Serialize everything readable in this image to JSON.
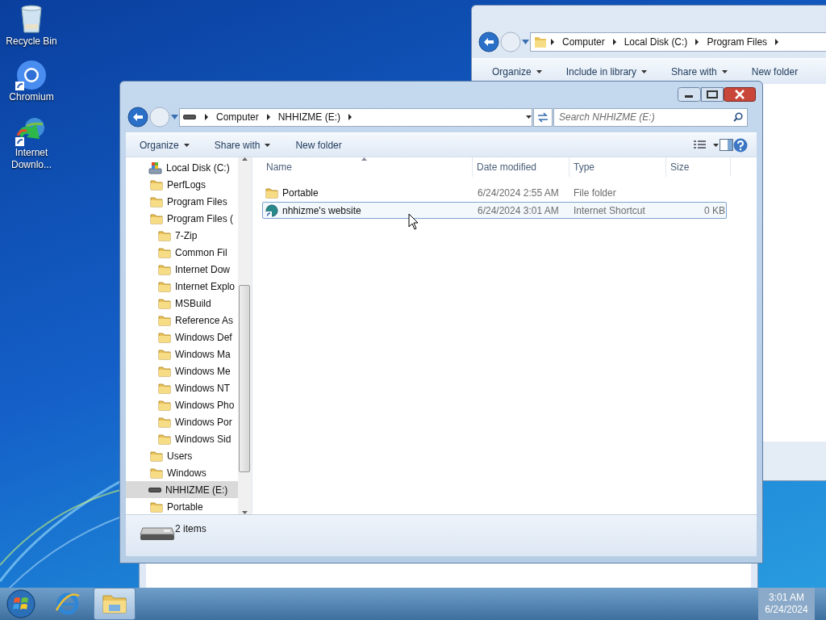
{
  "desktop_icons": [
    {
      "label": "Recycle Bin",
      "kind": "recycle"
    },
    {
      "label": "Chromium",
      "kind": "chromium"
    },
    {
      "label": "Internet Downlo...",
      "kind": "downloader"
    }
  ],
  "back_window": {
    "breadcrumb": [
      "Computer",
      "Local Disk (C:)",
      "Program Files"
    ],
    "toolbar": [
      {
        "label": "Organize",
        "dropdown": true
      },
      {
        "label": "Include in library",
        "dropdown": true
      },
      {
        "label": "Share with",
        "dropdown": true
      },
      {
        "label": "New folder",
        "dropdown": false
      }
    ]
  },
  "window": {
    "breadcrumb": [
      "Computer",
      "NHHIZME (E:)"
    ],
    "search": {
      "placeholder": "Search NHHIZME (E:)"
    },
    "toolbar": [
      {
        "label": "Organize",
        "dropdown": true
      },
      {
        "label": "Share with",
        "dropdown": true
      },
      {
        "label": "New folder",
        "dropdown": false
      }
    ],
    "nav_tree": [
      {
        "label": "Local Disk (C:)",
        "kind": "system-drive",
        "selected": false,
        "children": [
          {
            "label": "PerfLogs",
            "kind": "folder",
            "selected": false
          },
          {
            "label": "Program Files",
            "kind": "folder",
            "selected": false
          },
          {
            "label": "Program Files (",
            "kind": "folder",
            "selected": false,
            "children": [
              {
                "label": "7-Zip",
                "kind": "folder",
                "selected": false
              },
              {
                "label": "Common Fil",
                "kind": "folder",
                "selected": false
              },
              {
                "label": "Internet Dow",
                "kind": "folder",
                "selected": false
              },
              {
                "label": "Internet Explo",
                "kind": "folder",
                "selected": false
              },
              {
                "label": "MSBuild",
                "kind": "folder",
                "selected": false
              },
              {
                "label": "Reference As",
                "kind": "folder",
                "selected": false
              },
              {
                "label": "Windows Def",
                "kind": "folder",
                "selected": false
              },
              {
                "label": "Windows Ma",
                "kind": "folder",
                "selected": false
              },
              {
                "label": "Windows Me",
                "kind": "folder",
                "selected": false
              },
              {
                "label": "Windows NT",
                "kind": "folder",
                "selected": false
              },
              {
                "label": "Windows Pho",
                "kind": "folder",
                "selected": false
              },
              {
                "label": "Windows Por",
                "kind": "folder",
                "selected": false
              },
              {
                "label": "Windows Sid",
                "kind": "folder",
                "selected": false
              }
            ]
          },
          {
            "label": "Users",
            "kind": "folder",
            "selected": false
          },
          {
            "label": "Windows",
            "kind": "folder",
            "selected": false
          }
        ]
      },
      {
        "label": "NHHIZME (E:)",
        "kind": "usb-drive",
        "selected": true,
        "children": [
          {
            "label": "Portable",
            "kind": "folder",
            "selected": false
          }
        ]
      }
    ],
    "columns": [
      "Name",
      "Date modified",
      "Type",
      "Size"
    ],
    "rows": [
      {
        "name": "Portable",
        "kind": "folder",
        "date": "6/24/2024 2:55 AM",
        "type": "File folder",
        "selected": false
      },
      {
        "name": "nhhizme's website",
        "kind": "shortcut",
        "date": "6/24/2024 3:01 AM",
        "type": "Internet Shortcut",
        "size": "0 KB",
        "selected": true
      }
    ],
    "status": "2 items"
  },
  "taskbar": {
    "items": [
      {
        "kind": "start",
        "active": false
      },
      {
        "kind": "browser",
        "active": false
      },
      {
        "kind": "explorer",
        "active": true
      }
    ],
    "time": "3:01 AM",
    "date": "6/24/2024"
  }
}
